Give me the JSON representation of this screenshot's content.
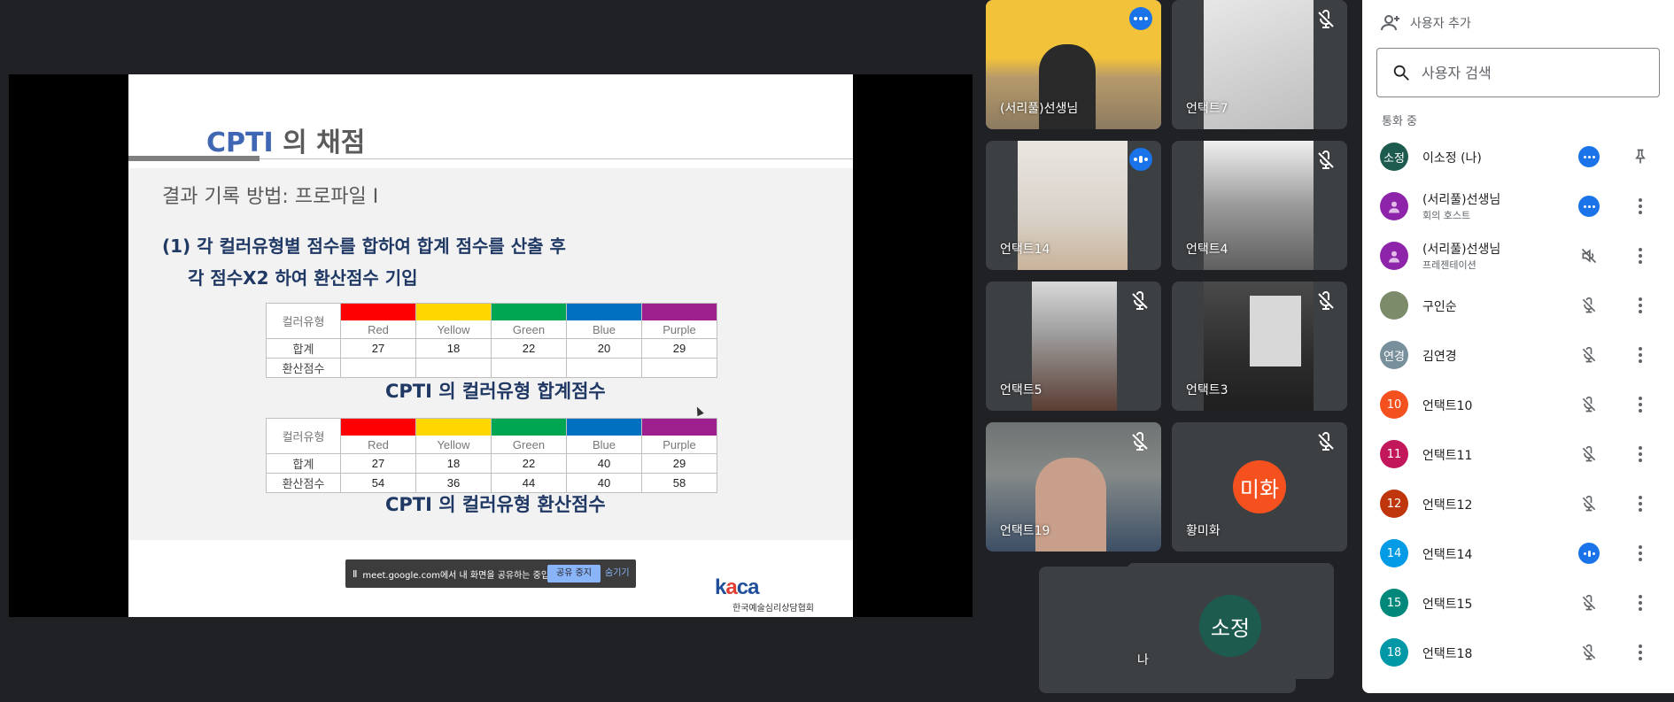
{
  "slide": {
    "title_accent": "CPTI",
    "title_rest": " 의 채점",
    "subtitle": "결과 기록 방법: 프로파일 Ⅰ",
    "step_line1": "(1) 각 컬러유형별 점수를 합하여 합계 점수를 산출 후",
    "step_line2": "각 점수X2 하여 환산점수 기입",
    "table_row_labels": [
      "컬러유형",
      "합계",
      "환산점수"
    ],
    "colors": [
      {
        "name": "Red",
        "hex": "#ff0000"
      },
      {
        "name": "Yellow",
        "hex": "#ffd700"
      },
      {
        "name": "Green",
        "hex": "#00a651"
      },
      {
        "name": "Blue",
        "hex": "#0070c0"
      },
      {
        "name": "Purple",
        "hex": "#9e1f8e"
      }
    ],
    "table1": {
      "sums": [
        "27",
        "18",
        "22",
        "20",
        "29"
      ],
      "converted": [
        "",
        "",
        "",
        "",
        ""
      ]
    },
    "table2": {
      "sums": [
        "27",
        "18",
        "22",
        "40",
        "29"
      ],
      "converted": [
        "54",
        "36",
        "44",
        "40",
        "58"
      ]
    },
    "caption1": "CPTI 의 컬러유형 합계점수",
    "caption2": "CPTI 의 컬러유형 환산점수",
    "logo_text_k": "k",
    "logo_text_a": "a",
    "logo_text_ca": "ca",
    "logo_org": "한국예술심리상담협회"
  },
  "share_bar": {
    "pause_icon": "Ⅱ",
    "message": "meet.google.com에서 내 화면을 공유하는 중입니다.",
    "stop_label": "공유 중지",
    "hide_label": "숨기기"
  },
  "tiles": [
    {
      "name": "(서리풀)선생님"
    },
    {
      "name": "언택트7"
    },
    {
      "name": "언택트14"
    },
    {
      "name": "언택트4"
    },
    {
      "name": "언택트5"
    },
    {
      "name": "언택트3"
    },
    {
      "name": "언택트19"
    },
    {
      "name": "황미화",
      "avatar": "미화"
    },
    {
      "name": "나",
      "avatar": "소정"
    }
  ],
  "panel": {
    "add_user_label": "사용자 추가",
    "search_placeholder": "사용자 검색",
    "section_label": "통화 중",
    "people": [
      {
        "name": "이소정 (나)",
        "initials": "소정",
        "color": "#1e5b4f"
      },
      {
        "name": "(서리풀)선생님",
        "role": "회의 호스트",
        "initials": "",
        "color": "#8e24aa"
      },
      {
        "name": "(서리풀)선생님",
        "role": "프레젠테이션",
        "initials": "",
        "color": "#8e24aa"
      },
      {
        "name": "구인순",
        "initials": "",
        "color": "#7c8b6a"
      },
      {
        "name": "김연경",
        "initials": "연경",
        "color": "#78909c"
      },
      {
        "name": "언택트10",
        "initials": "10",
        "color": "#f4511e"
      },
      {
        "name": "언택트11",
        "initials": "11",
        "color": "#c2185b"
      },
      {
        "name": "언택트12",
        "initials": "12",
        "color": "#bf360c"
      },
      {
        "name": "언택트14",
        "initials": "14",
        "color": "#039be5"
      },
      {
        "name": "언택트15",
        "initials": "15",
        "color": "#00897b"
      },
      {
        "name": "언택트18",
        "initials": "18",
        "color": "#0097a7"
      }
    ]
  }
}
